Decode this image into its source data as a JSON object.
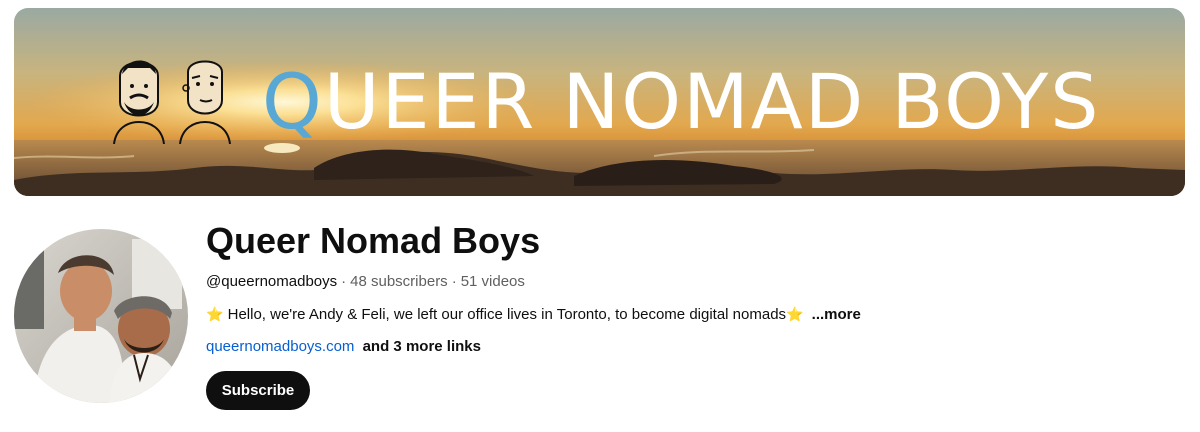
{
  "banner": {
    "title_initial": "Q",
    "title_rest": "UEER NOMAD BOYS",
    "accent_color": "#58a7d4"
  },
  "channel": {
    "name": "Queer Nomad Boys",
    "handle": "@queernomadboys",
    "subscribers": "48 subscribers",
    "videos": "51 videos",
    "separator": "·",
    "description": "Hello, we're Andy & Feli, we left our office lives in Toronto, to become digital nomads",
    "star_icon": "⭐",
    "more_label": "...more",
    "link_text": "queernomadboys.com",
    "more_links": "and 3 more links",
    "subscribe_label": "Subscribe"
  }
}
